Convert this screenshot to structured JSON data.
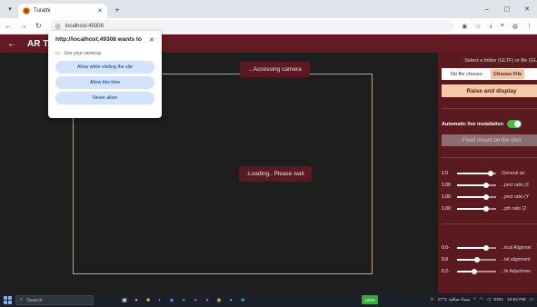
{
  "browser": {
    "tab_title": "Turathi",
    "url": "localhost:49308",
    "window_controls": [
      "–",
      "▢",
      "✕"
    ]
  },
  "app": {
    "title": "AR T"
  },
  "permission_popup": {
    "heading": "http://localhost:49308 wants to",
    "request": "Use your cameras",
    "allow_visit": "Allow while visiting the site",
    "allow_once": "Allow this time",
    "never": "Never allow"
  },
  "stage": {
    "accessing": "...Accessing camera",
    "loading": ".Loading.. Please wait"
  },
  "sidebar": {
    "select_label": ".Select a folder (GLTF) or file (GL",
    "no_file": "No file chosen",
    "choose_file": "Choose File",
    "raise_display": "Raise and display",
    "auto_install": "Automatic live installation",
    "auto_install_on": true,
    "fixed_mount": "Fixed mount on the shot",
    "sliders": [
      {
        "value": "1.0",
        "name": ".General siz",
        "level": 0.85
      },
      {
        "value": "1.00",
        "name": "...pect ratio (X",
        "level": 0.75
      },
      {
        "value": "1.00",
        "name": "...pect ratio (Y",
        "level": 0.75
      },
      {
        "value": "1.00",
        "name": "...pth ratio (Z",
        "level": 0.75
      }
    ],
    "sliders2": [
      {
        "value": "0.0-",
        "name": "...tical Alignmer",
        "level": 0.75
      },
      {
        "value": "0.0",
        "name": "...tal alignment",
        "level": 0.5
      },
      {
        "value": "0.2-",
        "name": "...th Adjustmen",
        "level": 0.45
      }
    ]
  },
  "taskbar": {
    "search": "Search",
    "status_badge": "100%",
    "weather": "17°C سماء صافية",
    "lang": "ENG",
    "time": "10:54 PM"
  }
}
